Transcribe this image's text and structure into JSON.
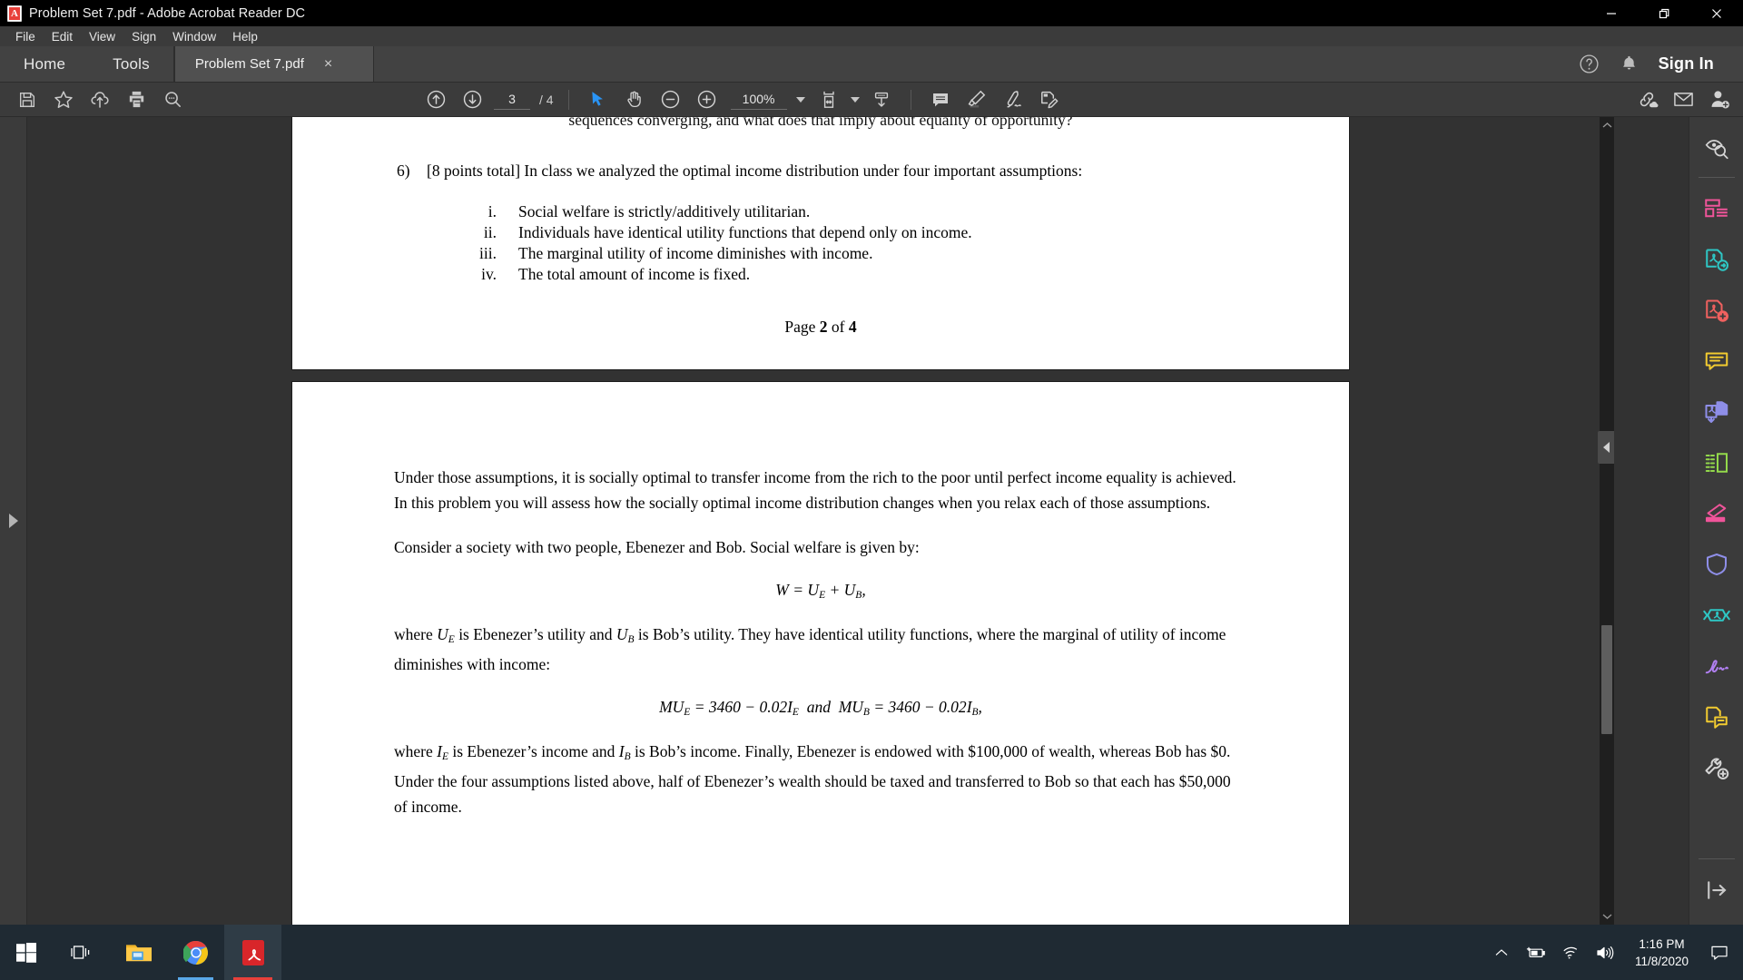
{
  "window": {
    "title": "Problem Set 7.pdf - Adobe Acrobat Reader DC",
    "app_icon": "adobe-acrobat-icon",
    "minimize_label": "Minimize",
    "restore_label": "Restore",
    "close_label": "Close"
  },
  "menubar": {
    "items": [
      {
        "label": "File"
      },
      {
        "label": "Edit"
      },
      {
        "label": "View"
      },
      {
        "label": "Sign"
      },
      {
        "label": "Window"
      },
      {
        "label": "Help"
      }
    ]
  },
  "tabstrip": {
    "home_label": "Home",
    "tools_label": "Tools",
    "document_tab": "Problem Set 7.pdf",
    "document_tab_close": "×",
    "help_icon": "help-circle-icon",
    "bell_icon": "bell-icon",
    "sign_in_label": "Sign In"
  },
  "toolbar": {
    "save_icon": "save-icon",
    "star_icon": "star-icon",
    "upload_cloud_icon": "upload-cloud-icon",
    "print_icon": "print-icon",
    "find_icon": "find-icon",
    "prev_page_icon": "arrow-up-circle-icon",
    "next_page_icon": "arrow-down-circle-icon",
    "page_number": "3",
    "page_total": "/ 4",
    "select_tool_icon": "cursor-select-icon",
    "hand_tool_icon": "hand-icon",
    "zoom_out_icon": "zoom-out-icon",
    "zoom_in_icon": "zoom-in-icon",
    "zoom_level": "100%",
    "fit_page_icon": "fit-page-icon",
    "scroll_mode_icon": "page-scroll-icon",
    "comment_icon": "comment-icon",
    "highlight_icon": "highlight-icon",
    "draw_icon": "draw-freehand-icon",
    "fill_sign_icon": "fill-and-sign-icon",
    "share_link_icon": "share-link-icon",
    "email_icon": "email-icon",
    "add_person_icon": "add-person-icon"
  },
  "left_rail": {
    "expand_icon": "expand-panel-arrow-icon"
  },
  "right_rail": {
    "items": [
      {
        "name": "search-pdf-icon",
        "color": "#d4d4d4"
      },
      {
        "name": "organize-pages-icon",
        "color": "#f0549a"
      },
      {
        "name": "export-pdf-icon",
        "color": "#2ec7c5"
      },
      {
        "name": "create-pdf-icon",
        "color": "#f0615f"
      },
      {
        "name": "comment-icon",
        "color": "#f2cb30"
      },
      {
        "name": "combine-files-icon",
        "color": "#8e8ee8"
      },
      {
        "name": "edit-pdf-icon",
        "color": "#93d94b"
      },
      {
        "name": "fill-and-sign-icon",
        "color": "#f0549a"
      },
      {
        "name": "protect-icon",
        "color": "#8e8ee8"
      },
      {
        "name": "compress-pdf-icon",
        "color": "#2ec7c5"
      },
      {
        "name": "request-signatures-icon",
        "color": "#b07ff0"
      },
      {
        "name": "add-comment-note-icon",
        "color": "#f2cb30"
      },
      {
        "name": "more-tools-icon",
        "color": "#d4d4d4"
      }
    ],
    "collapse_icon": "collapse-panel-icon"
  },
  "viewer": {
    "collapse_handle_icon": "collapse-right-panel-icon",
    "scroll_up_icon": "scroll-up-chevron-icon",
    "scroll_down_icon": "scroll-down-chevron-icon",
    "scrollbar_thumb": "vertical-scroll-thumb"
  },
  "document": {
    "page_top": {
      "clipped_line": "sequences converging, and what does that imply about equality of opportunity?",
      "question_number": "6)",
      "question_text": "[8 points total] In class we analyzed the optimal income distribution under four important assumptions:",
      "assumptions": [
        {
          "marker": "i.",
          "text": "Social welfare is strictly/additively utilitarian."
        },
        {
          "marker": "ii.",
          "text": "Individuals have identical utility functions that depend only on income."
        },
        {
          "marker": "iii.",
          "text": "The marginal utility of income diminishes with income."
        },
        {
          "marker": "iv.",
          "text": "The total amount of income is fixed."
        }
      ],
      "footer_prefix": "Page ",
      "footer_page": "2",
      "footer_mid": " of ",
      "footer_total": "4"
    },
    "page_bottom": {
      "para1": "Under those assumptions, it is socially optimal to transfer income from the rich to the poor until perfect income equality is achieved.  In this problem you will assess how the socially optimal income distribution changes when you relax each of those assumptions.",
      "para2": "Consider a society with two people, Ebenezer and Bob.  Social welfare is given by:",
      "equation1": "W = U_E + U_B,",
      "para3_a": "where ",
      "para3_b": " is Ebenezer’s utility and ",
      "para3_c": " is Bob’s utility.  They have identical utility functions, where the marginal of utility of income diminishes with income:",
      "equation2": "MU_E = 3460 − 0.02I_E  and  MU_B = 3460 − 0.02I_B,",
      "para4_a": "where ",
      "para4_b": " is Ebenezer’s income and ",
      "para4_c": " is Bob’s income.  Finally, Ebenezer is endowed with $100,000 of wealth, whereas Bob has $0.  Under the four assumptions listed above, half of Ebenezer’s wealth should be taxed and transferred to Bob so that each has $50,000 of income."
    }
  },
  "taskbar": {
    "start_icon": "windows-start-icon",
    "task_view_icon": "task-view-icon",
    "file_explorer_icon": "file-explorer-icon",
    "chrome_icon": "google-chrome-icon",
    "acrobat_icon": "adobe-acrobat-icon",
    "tray_chevron_icon": "show-hidden-icons-chevron",
    "battery_icon": "battery-charging-icon",
    "wifi_icon": "wifi-icon",
    "volume_icon": "volume-icon",
    "time": "1:16 PM",
    "date": "11/8/2020",
    "action_center_icon": "action-center-icon"
  }
}
